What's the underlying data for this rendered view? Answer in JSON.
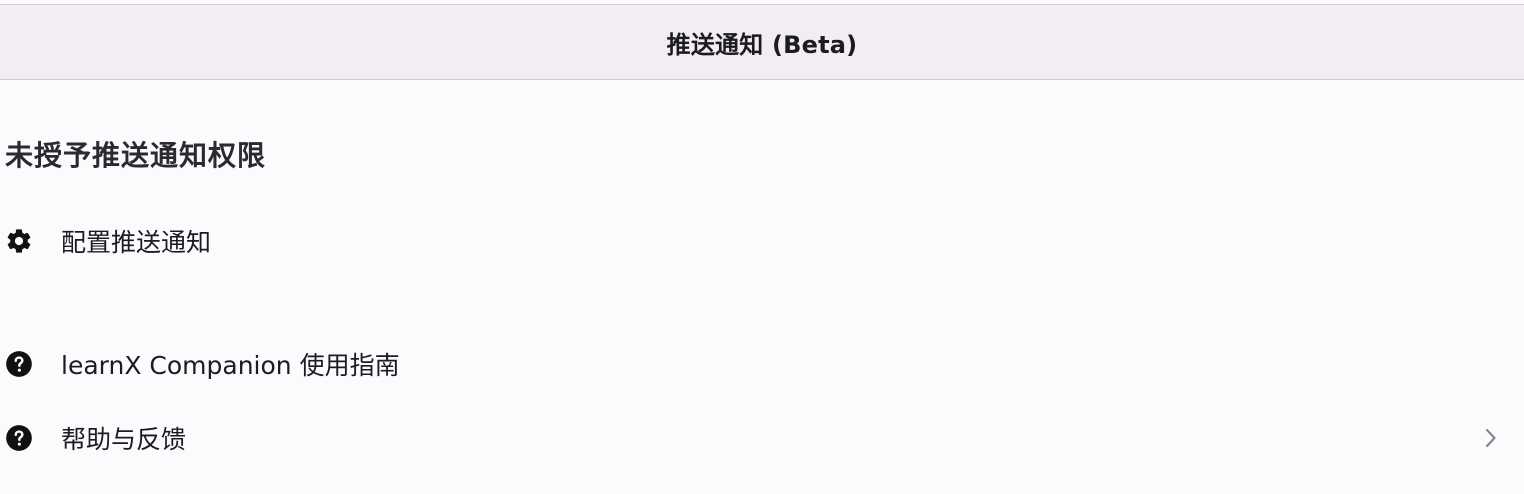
{
  "navbar": {
    "title": "推送通知 (Beta)"
  },
  "permission_section": {
    "header": "未授予推送通知权限",
    "items": [
      {
        "label": "配置推送通知",
        "icon": "gear-icon"
      }
    ]
  },
  "help_section": {
    "items": [
      {
        "label": "learnX Companion 使用指南",
        "icon": "question-circle-icon"
      },
      {
        "label": "帮助与反馈",
        "icon": "question-circle-icon",
        "chevron": "chevron-right-icon"
      }
    ]
  },
  "colors": {
    "navbar_background": "#f1edf3",
    "page_background": "#fcfafd",
    "text": "#1c1b1f",
    "icon": "#111111",
    "chevron": "#8a878c"
  }
}
